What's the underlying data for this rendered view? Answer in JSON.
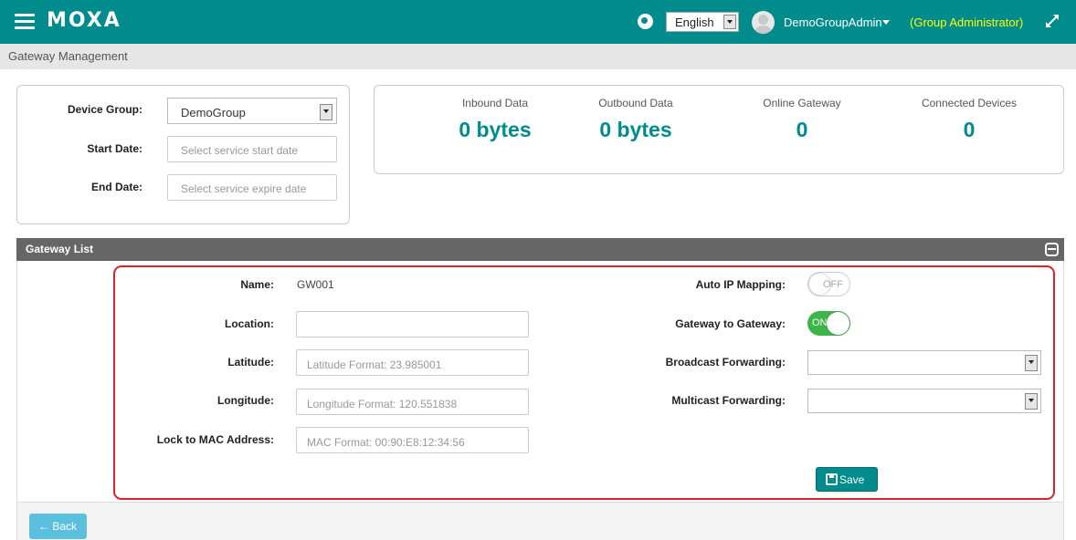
{
  "topbar": {
    "logo": "MOXA",
    "language": "English",
    "username": "DemoGroupAdmin",
    "role": "(Group Administrator)",
    "icons": [
      "hamburger-menu-icon",
      "globe-icon",
      "chevron-down-icon",
      "expand-icon"
    ],
    "colors": {
      "bar": "#008c8c",
      "role_text": "#ffff00"
    }
  },
  "breadcrumb": "Gateway Management",
  "filters": {
    "device_group_label": "Device Group:",
    "device_group_value": "DemoGroup",
    "start_date_label": "Start Date:",
    "start_date_placeholder": "Select service start date",
    "end_date_label": "End Date:",
    "end_date_placeholder": "Select service expire date"
  },
  "stats": [
    {
      "label": "Inbound Data",
      "value": "0 bytes"
    },
    {
      "label": "Outbound Data",
      "value": "0 bytes"
    },
    {
      "label": "Online Gateway",
      "value": "0"
    },
    {
      "label": "Connected Devices",
      "value": "0"
    }
  ],
  "gateway_list": {
    "title": "Gateway List",
    "name_label": "Name:",
    "name_value": "GW001",
    "location_label": "Location:",
    "location_value": "",
    "latitude_label": "Latitude:",
    "latitude_placeholder": "Latitude Format: 23.985001",
    "longitude_label": "Longitude:",
    "longitude_placeholder": "Longitude Format: 120.551838",
    "mac_label": "Lock to MAC Address:",
    "mac_placeholder": "MAC Format: 00:90:E8:12:34:56",
    "auto_ip_label": "Auto IP Mapping:",
    "auto_ip_state": "OFF",
    "g2g_label": "Gateway to Gateway:",
    "g2g_state": "ON",
    "broadcast_label": "Broadcast Forwarding:",
    "broadcast_value": "",
    "multicast_label": "Multicast Forwarding:",
    "multicast_value": "",
    "save_label": "Save",
    "colors": {
      "toggle_on": "#3cb54a",
      "highlight": "#e0202a"
    }
  },
  "back_label": "Back"
}
